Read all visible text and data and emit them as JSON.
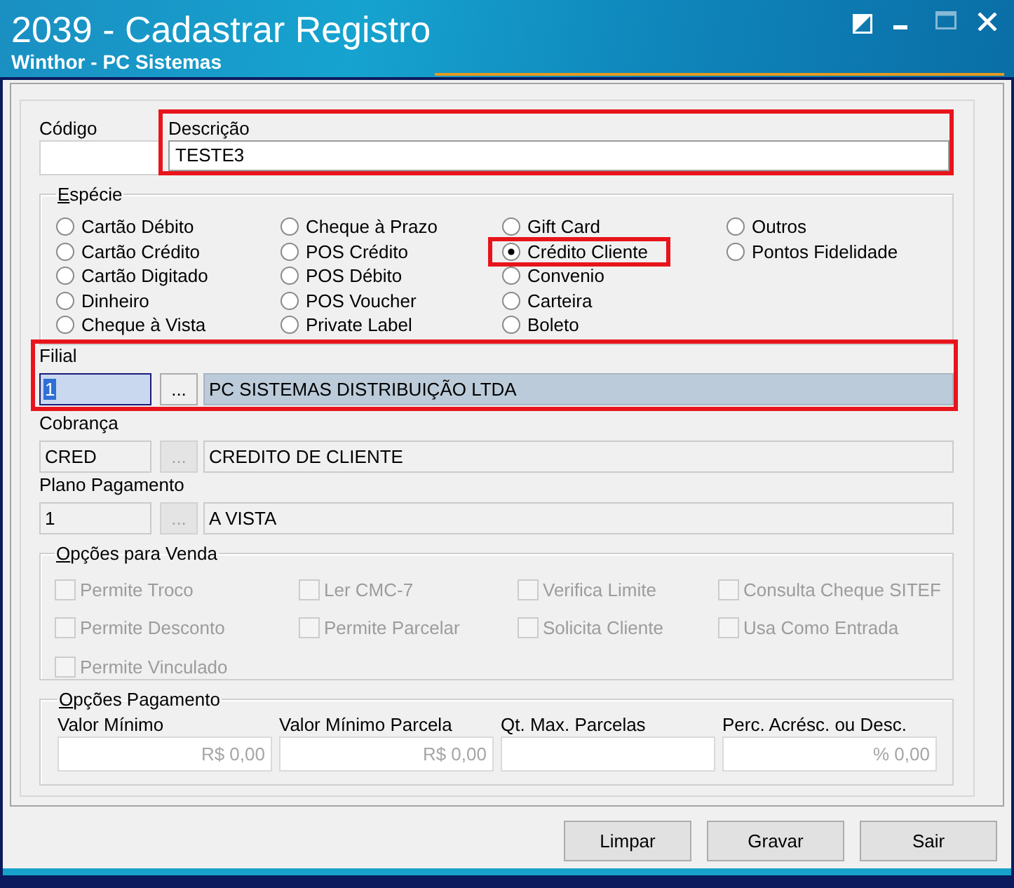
{
  "window": {
    "title": "2039 - Cadastrar Registro",
    "subtitle": "Winthor - PC Sistemas",
    "controls": [
      {
        "kind": "theme",
        "disabled": false
      },
      {
        "kind": "minimize",
        "disabled": false
      },
      {
        "kind": "maximize",
        "disabled": true
      },
      {
        "kind": "close",
        "disabled": false
      }
    ]
  },
  "codigo": {
    "label": "Código"
  },
  "descricao": {
    "label": "Descrição",
    "value": "TESTE3",
    "highlighted": true
  },
  "especie": {
    "legend": "Espécie",
    "columns": [
      {
        "options": [
          {
            "label": "Cartão Débito",
            "selected": false,
            "highlighted": false
          },
          {
            "label": "Cartão Crédito",
            "selected": false,
            "highlighted": false
          },
          {
            "label": "Cartão Digitado",
            "selected": false,
            "highlighted": false
          },
          {
            "label": "Dinheiro",
            "selected": false,
            "highlighted": false
          },
          {
            "label": "Cheque à Vista",
            "selected": false,
            "highlighted": false
          }
        ]
      },
      {
        "options": [
          {
            "label": "Cheque à Prazo",
            "selected": false,
            "highlighted": false
          },
          {
            "label": "POS Crédito",
            "selected": false,
            "highlighted": false
          },
          {
            "label": "POS Débito",
            "selected": false,
            "highlighted": false
          },
          {
            "label": "POS Voucher",
            "selected": false,
            "highlighted": false
          },
          {
            "label": "Private Label",
            "selected": false,
            "highlighted": false
          }
        ]
      },
      {
        "options": [
          {
            "label": "Gift Card",
            "selected": false,
            "highlighted": false
          },
          {
            "label": "Crédito Cliente",
            "selected": true,
            "highlighted": true
          },
          {
            "label": "Convenio",
            "selected": false,
            "highlighted": false
          },
          {
            "label": "Carteira",
            "selected": false,
            "highlighted": false
          },
          {
            "label": "Boleto",
            "selected": false,
            "highlighted": false
          }
        ]
      },
      {
        "options": [
          {
            "label": "Outros",
            "selected": false,
            "highlighted": false
          },
          {
            "label": "Pontos Fidelidade",
            "selected": false,
            "highlighted": false
          }
        ]
      }
    ]
  },
  "lookups": [
    {
      "label": "Filial",
      "code": "1",
      "button": "...",
      "description": "PC SISTEMAS DISTRIBUIÇÃO LTDA",
      "disabled": false,
      "focused": true,
      "highlighted": true
    },
    {
      "label": "Cobrança",
      "code": "CRED",
      "button": "...",
      "description": "CREDITO DE CLIENTE",
      "disabled": true,
      "focused": false,
      "highlighted": false
    },
    {
      "label": "Plano Pagamento",
      "code": "1",
      "button": "...",
      "description": "A VISTA",
      "disabled": true,
      "focused": false,
      "highlighted": false
    }
  ],
  "opcoes_venda": {
    "legend": "Opções para Venda",
    "columns": [
      {
        "options": [
          {
            "label": "Permite Troco",
            "checked": false,
            "disabled": true
          },
          {
            "label": "Permite Desconto",
            "checked": false,
            "disabled": true
          },
          {
            "label": "Permite Vinculado",
            "checked": false,
            "disabled": true
          }
        ]
      },
      {
        "options": [
          {
            "label": "Ler CMC-7",
            "checked": false,
            "disabled": true
          },
          {
            "label": "Permite Parcelar",
            "checked": false,
            "disabled": true
          }
        ]
      },
      {
        "options": [
          {
            "label": "Verifica Limite",
            "checked": false,
            "disabled": true
          },
          {
            "label": "Solicita Cliente",
            "checked": false,
            "disabled": true
          }
        ]
      },
      {
        "options": [
          {
            "label": "Consulta Cheque SITEF",
            "checked": false,
            "disabled": true
          },
          {
            "label": "Usa Como Entrada",
            "checked": false,
            "disabled": true
          }
        ]
      }
    ]
  },
  "opcoes_pagamento": {
    "legend": "Opções Pagamento",
    "fields": [
      {
        "label": "Valor Mínimo",
        "placeholder": "R$ 0,00"
      },
      {
        "label": "Valor Mínimo Parcela",
        "placeholder": "R$ 0,00"
      },
      {
        "label": "Qt. Max. Parcelas"
      },
      {
        "label": "Perc. Acrésc. ou Desc.",
        "placeholder": "% 0,00"
      }
    ]
  },
  "buttons": [
    {
      "label": "Limpar"
    },
    {
      "label": "Gravar"
    },
    {
      "label": "Sair"
    }
  ]
}
